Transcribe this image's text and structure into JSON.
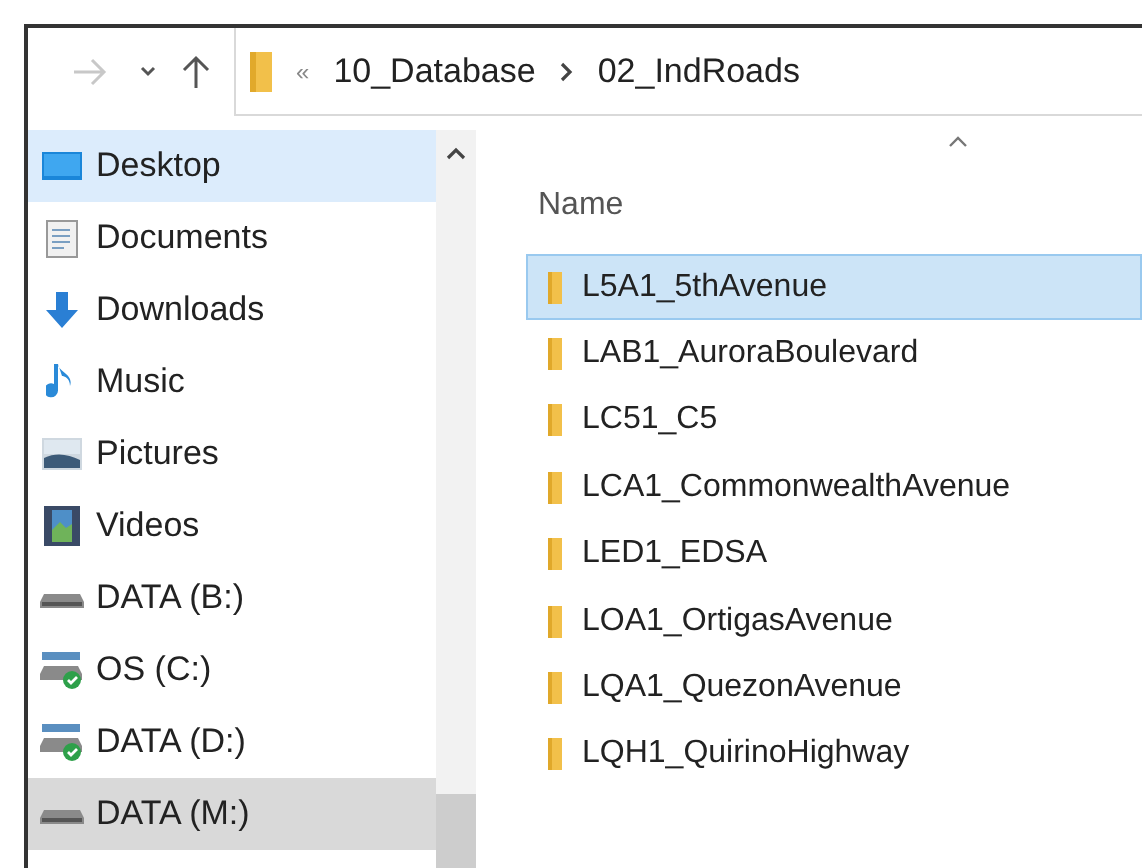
{
  "address_bar": {
    "overflow": "«",
    "path": [
      "10_Database",
      "02_IndRoads"
    ]
  },
  "nav_pane": {
    "items": [
      {
        "label": "Desktop",
        "kind": "desktop",
        "selected": true,
        "hovered": false
      },
      {
        "label": "Documents",
        "kind": "documents",
        "selected": false,
        "hovered": false
      },
      {
        "label": "Downloads",
        "kind": "downloads",
        "selected": false,
        "hovered": false
      },
      {
        "label": "Music",
        "kind": "music",
        "selected": false,
        "hovered": false
      },
      {
        "label": "Pictures",
        "kind": "pictures",
        "selected": false,
        "hovered": false
      },
      {
        "label": "Videos",
        "kind": "videos",
        "selected": false,
        "hovered": false
      },
      {
        "label": "DATA (B:)",
        "kind": "drive",
        "selected": false,
        "hovered": false
      },
      {
        "label": "OS (C:)",
        "kind": "system-drive",
        "selected": false,
        "hovered": false
      },
      {
        "label": "DATA (D:)",
        "kind": "system-drive",
        "selected": false,
        "hovered": false
      },
      {
        "label": "DATA (M:)",
        "kind": "drive",
        "selected": false,
        "hovered": true
      }
    ]
  },
  "file_list": {
    "columns": [
      "Name"
    ],
    "rows": [
      {
        "name": "L5A1_5thAvenue",
        "selected": true
      },
      {
        "name": "LAB1_AuroraBoulevard",
        "selected": false
      },
      {
        "name": "LC51_C5",
        "selected": false
      },
      {
        "name": "LCA1_CommonwealthAvenue",
        "selected": false
      },
      {
        "name": "LED1_EDSA",
        "selected": false
      },
      {
        "name": "LOA1_OrtigasAvenue",
        "selected": false
      },
      {
        "name": "LQA1_QuezonAvenue",
        "selected": false
      },
      {
        "name": "LQH1_QuirinoHighway",
        "selected": false
      }
    ]
  }
}
